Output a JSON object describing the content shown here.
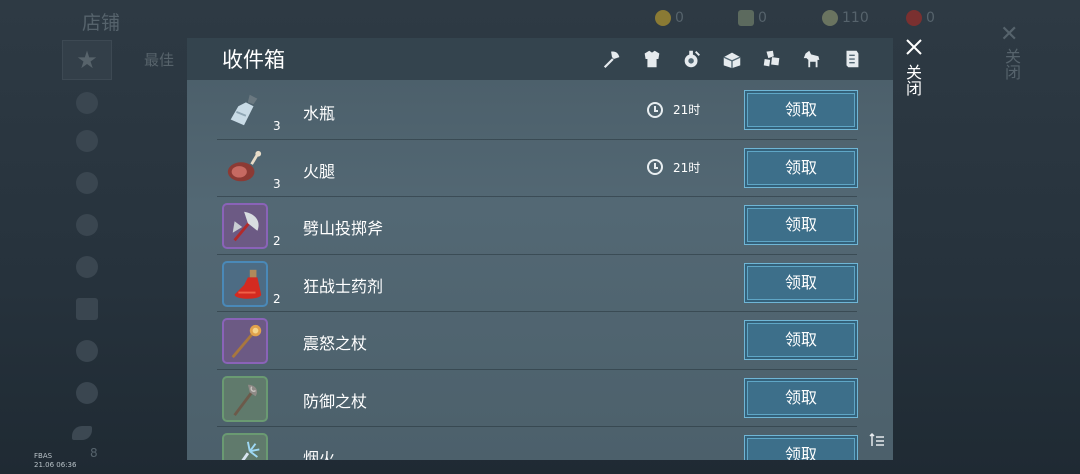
{
  "background": {
    "title": "店铺",
    "currencies": [
      {
        "icon": "gold-coin-icon",
        "value": "0",
        "color": "#8a7a34"
      },
      {
        "icon": "resource-icon",
        "value": "0",
        "color": "#5c6a5e"
      },
      {
        "icon": "silver-coin-icon",
        "value": "110",
        "color": "#6a7460"
      },
      {
        "icon": "ruby-icon",
        "value": "0",
        "color": "#7a3030"
      }
    ],
    "tab_best": "最佳",
    "close_label": "关闭",
    "count_badge": "8",
    "device_info_1": "FBAS",
    "device_info_2": "21.06 06:36"
  },
  "mailbox": {
    "title": "收件箱",
    "filters": [
      "axe-icon",
      "armor-icon",
      "potion-icon",
      "chest-icon",
      "resources-icon",
      "horse-icon",
      "book-icon"
    ],
    "close_label": "关闭",
    "claim_label": "领取",
    "items": [
      {
        "name": "水瓶",
        "qty": "3",
        "timer": "21时",
        "rarity": "plain",
        "icon": "water-flask-icon"
      },
      {
        "name": "火腿",
        "qty": "3",
        "timer": "21时",
        "rarity": "plain",
        "icon": "ham-icon"
      },
      {
        "name": "劈山投掷斧",
        "qty": "2",
        "timer": "",
        "rarity": "purple",
        "icon": "throwing-axe-icon"
      },
      {
        "name": "狂战士药剂",
        "qty": "2",
        "timer": "",
        "rarity": "blue",
        "icon": "berserker-potion-icon"
      },
      {
        "name": "震怒之杖",
        "qty": "",
        "timer": "",
        "rarity": "purple",
        "icon": "staff-of-wrath-icon"
      },
      {
        "name": "防御之杖",
        "qty": "",
        "timer": "",
        "rarity": "green",
        "icon": "staff-of-defense-icon"
      },
      {
        "name": "烟火",
        "qty": "",
        "timer": "",
        "rarity": "green",
        "icon": "firework-icon"
      }
    ]
  }
}
